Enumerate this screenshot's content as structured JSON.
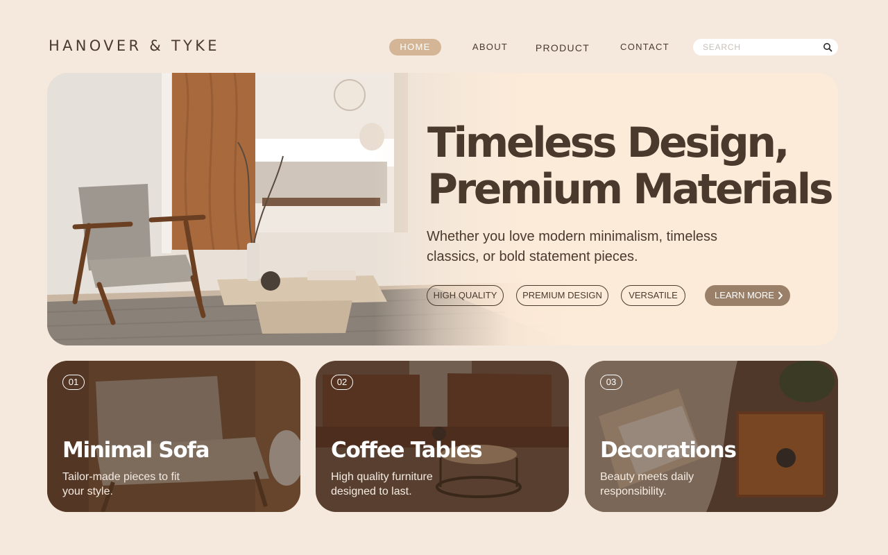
{
  "brand": {
    "name": "HANOVER & TYKE"
  },
  "nav": {
    "items": [
      {
        "label": "HOME",
        "active": true
      },
      {
        "label": "ABOUT",
        "active": false
      },
      {
        "label": "PRODUCT",
        "active": false
      },
      {
        "label": "CONTACT",
        "active": false
      }
    ],
    "search_placeholder": "SEARCH",
    "search_icon": "search-icon"
  },
  "hero": {
    "title_line1": "Timeless Design,",
    "title_line2": "Premium Materials",
    "subtitle": "Whether you love modern minimalism, timeless classics, or bold statement pieces.",
    "tags": [
      "HIGH QUALITY",
      "PREMIUM DESIGN",
      "VERSATILE"
    ],
    "cta_label": "LEARN MORE",
    "cta_icon": "chevron-right-icon"
  },
  "cards": [
    {
      "number": "01",
      "title": "Minimal Sofa",
      "description": "Tailor-made pieces to fit your style."
    },
    {
      "number": "02",
      "title": "Coffee Tables",
      "description": "High quality furniture designed to last."
    },
    {
      "number": "03",
      "title": "Decorations",
      "description": "Beauty meets daily responsibility."
    }
  ],
  "colors": {
    "background": "#f5e8dc",
    "hero_panel": "#fdebd9",
    "text_dark": "#4a3a2e",
    "nav_active": "#d4b696",
    "cta": "#9a8068"
  }
}
